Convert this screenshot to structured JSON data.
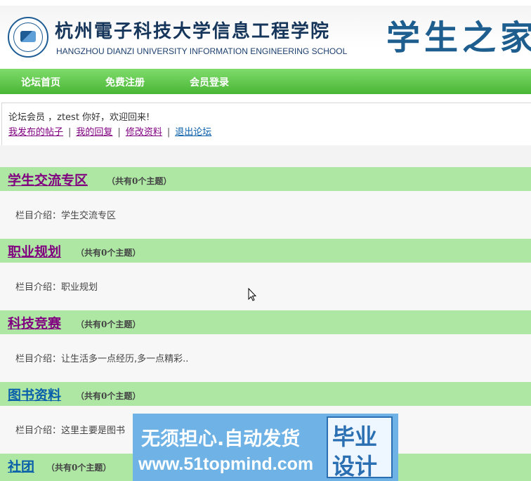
{
  "header": {
    "school_cn": "杭州電子科技大学信息工程学院",
    "school_en": "HANGZHOU DIANZI UNIVERSITY INFORMATION ENGINEERING SCHOOL",
    "slogan": "学生之家"
  },
  "nav": {
    "items": [
      {
        "label": "论坛首页"
      },
      {
        "label": "免费注册"
      },
      {
        "label": "会员登录"
      }
    ]
  },
  "user": {
    "welcome": "论坛会员 ，ztest 你好，欢迎回来!",
    "links": [
      {
        "label": "我发布的帖子"
      },
      {
        "label": "我的回复"
      },
      {
        "label": "修改资料"
      },
      {
        "label": "退出论坛"
      }
    ],
    "separator": "|"
  },
  "sections": [
    {
      "title": "学生交流专区",
      "count": "（共有0个主题）",
      "intro": "栏目介绍：学生交流专区"
    },
    {
      "title": "职业规划",
      "count": "（共有0个主题）",
      "intro": "栏目介绍：职业规划"
    },
    {
      "title": "科技竞赛",
      "count": "（共有0个主题）",
      "intro": "栏目介绍：让生活多一点经历,多一点精彩.."
    },
    {
      "title": "图书资料",
      "count": "（共有0个主题）",
      "intro": "栏目介绍：这里主要是图书"
    },
    {
      "title": "社团",
      "count": "（共有0个主题）",
      "intro": ""
    }
  ],
  "banner": {
    "line1": "无须担心.自动发货",
    "line2": "www.51topmind.com",
    "box_line1": "毕业",
    "box_line2": "设计"
  }
}
